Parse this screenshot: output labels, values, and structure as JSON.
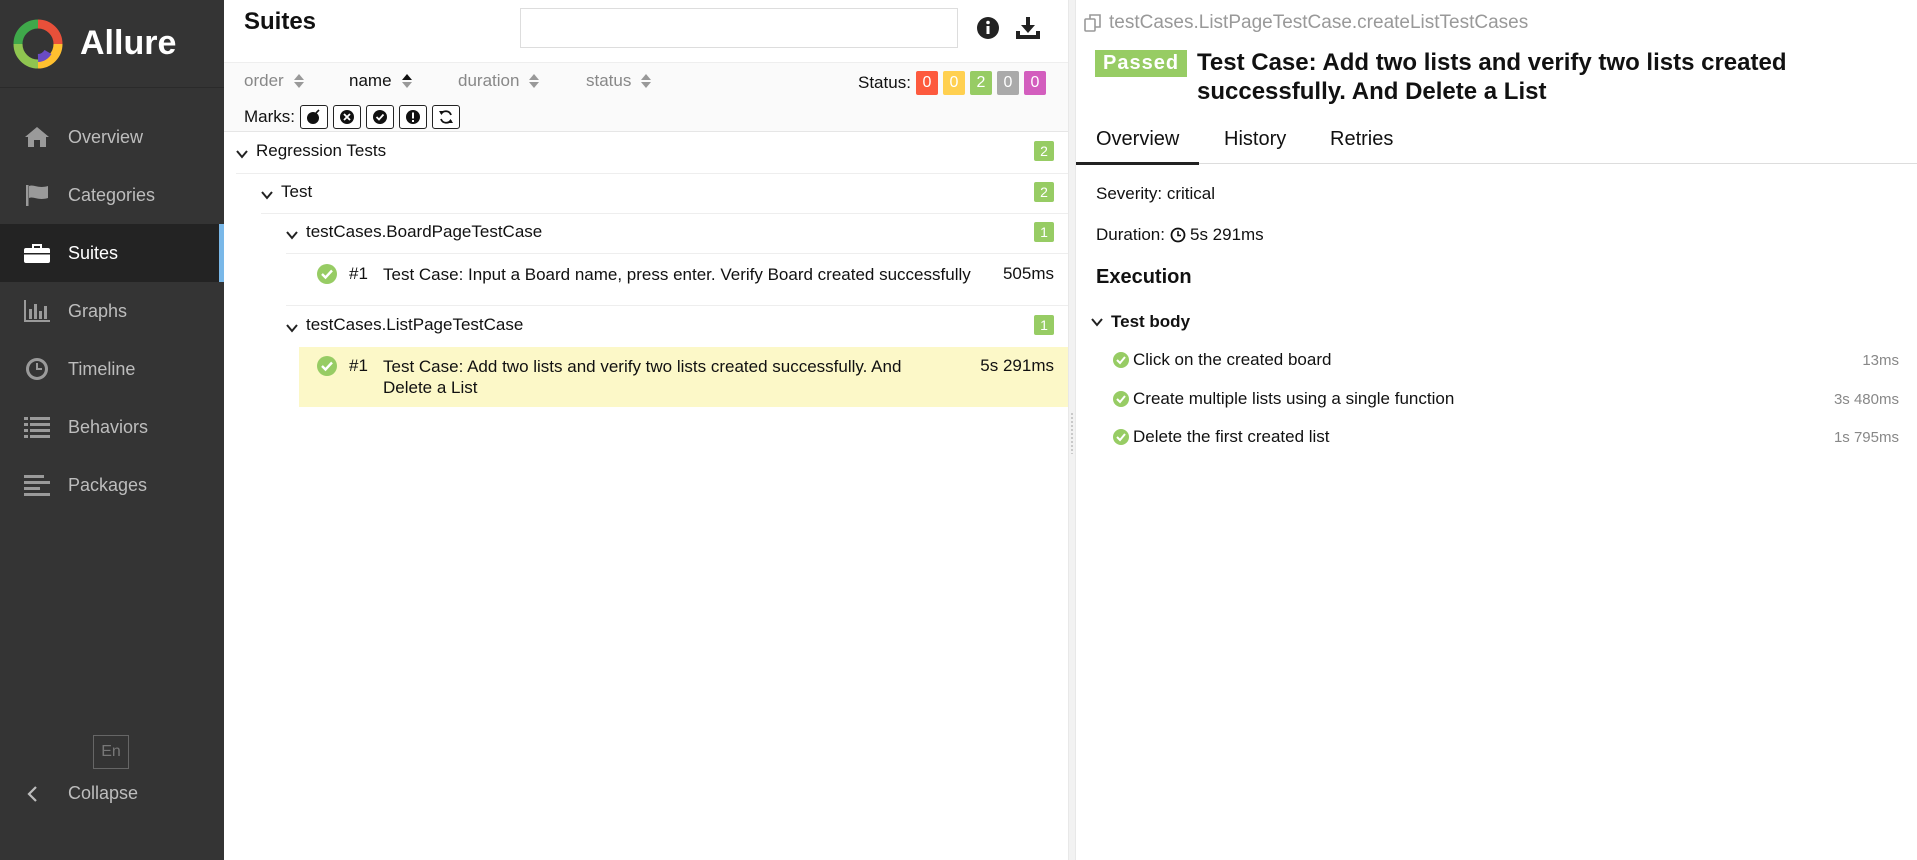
{
  "app": {
    "name": "Allure"
  },
  "sidebar": {
    "items": [
      {
        "label": "Overview"
      },
      {
        "label": "Categories"
      },
      {
        "label": "Suites"
      },
      {
        "label": "Graphs"
      },
      {
        "label": "Timeline"
      },
      {
        "label": "Behaviors"
      },
      {
        "label": "Packages"
      }
    ],
    "active": "Suites",
    "lang": "En",
    "collapse_label": "Collapse"
  },
  "suites": {
    "title": "Suites",
    "search_value": "",
    "sort": [
      {
        "label": "order"
      },
      {
        "label": "name"
      },
      {
        "label": "duration"
      },
      {
        "label": "status"
      }
    ],
    "active_sort": "name",
    "status_label": "Status:",
    "status_counts": [
      {
        "value": "0",
        "color": "#fd5a3e"
      },
      {
        "value": "0",
        "color": "#ffd050"
      },
      {
        "value": "2",
        "color": "#97cc64"
      },
      {
        "value": "0",
        "color": "#aaaaaa"
      },
      {
        "value": "0",
        "color": "#d35ebe"
      }
    ],
    "marks_label": "Marks:",
    "tree": {
      "root": {
        "name": "Regression Tests",
        "count": "2"
      },
      "group": {
        "name": "Test",
        "count": "2"
      },
      "classes": [
        {
          "name": "testCases.BoardPageTestCase",
          "count": "1",
          "tests": [
            {
              "num": "#1",
              "name": "Test Case: Input a Board name, press enter. Verify Board created successfully",
              "duration": "505ms"
            }
          ]
        },
        {
          "name": "testCases.ListPageTestCase",
          "count": "1",
          "tests": [
            {
              "num": "#1",
              "name_line1": "Test Case: Add two lists and verify two lists created successfully. And",
              "name_line2": "Delete a List",
              "duration": "5s 291ms"
            }
          ]
        }
      ]
    }
  },
  "detail": {
    "full_name": "testCases.ListPageTestCase.createListTestCases",
    "status": "Passed",
    "title_line1": "Test Case: Add two lists and verify two lists created",
    "title_line2": "successfully. And Delete a List",
    "tabs": [
      {
        "label": "Overview"
      },
      {
        "label": "History"
      },
      {
        "label": "Retries"
      }
    ],
    "severity": "Severity: critical",
    "duration_label": "Duration:",
    "duration_value": "5s 291ms",
    "execution_title": "Execution",
    "test_body": "Test body",
    "steps": [
      {
        "name": "Click on the created board",
        "duration": "13ms"
      },
      {
        "name": "Create multiple lists using a single function",
        "duration": "3s 480ms"
      },
      {
        "name": "Delete the first created list",
        "duration": "1s 795ms"
      }
    ]
  }
}
